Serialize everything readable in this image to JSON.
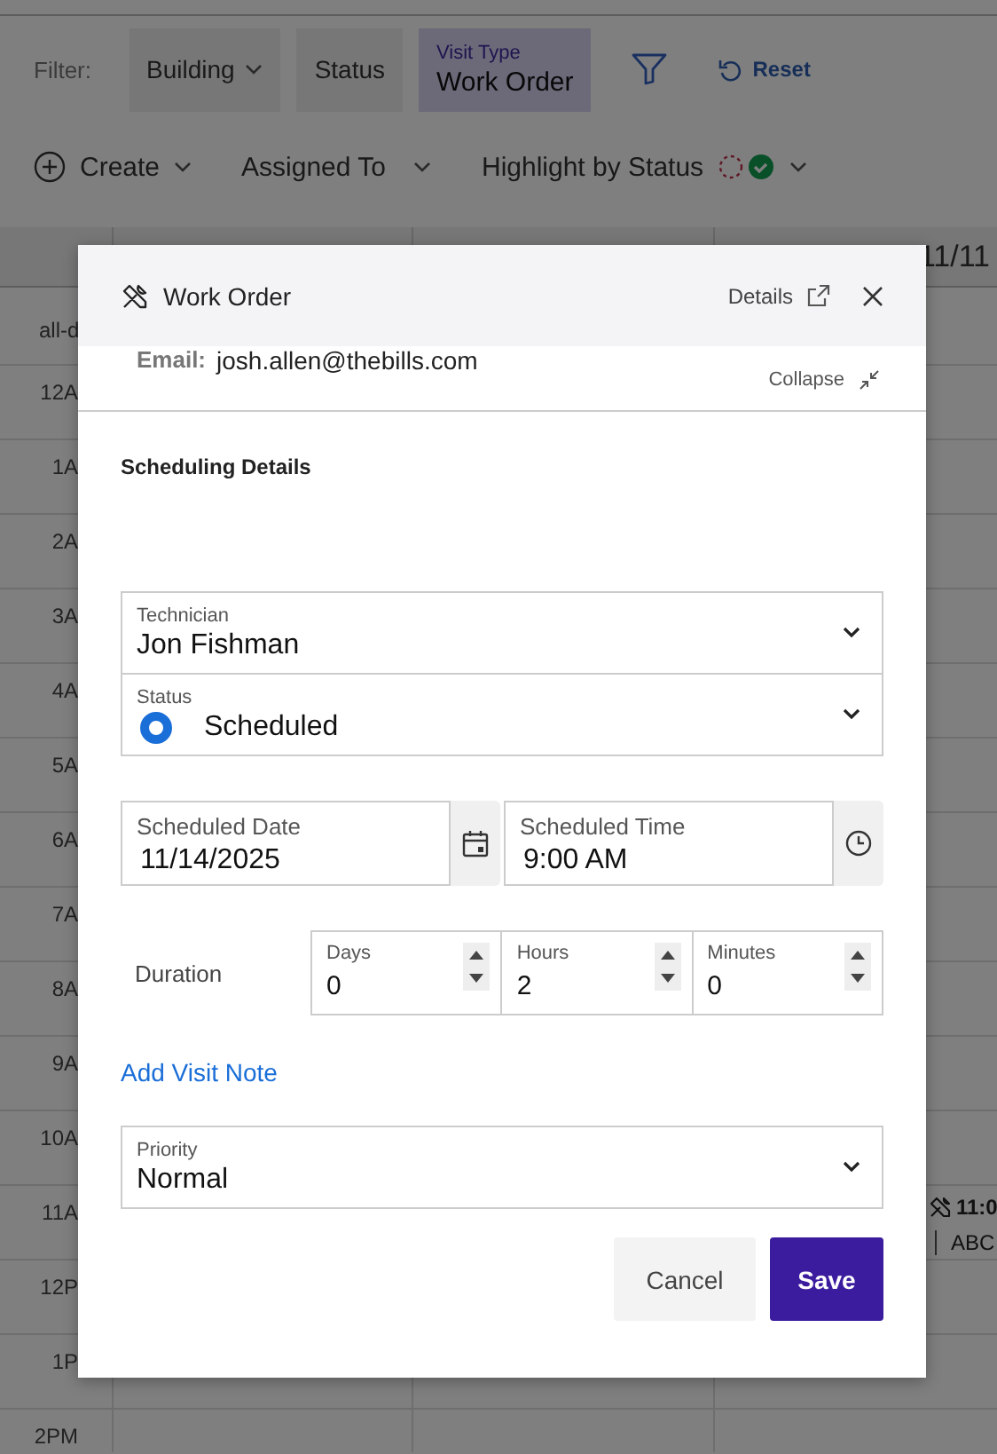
{
  "filter_bar": {
    "label": "Filter:",
    "chips": [
      {
        "kind": "dropdown",
        "label": "Building",
        "selected": false
      },
      {
        "kind": "plain",
        "label": "Status",
        "selected": false
      },
      {
        "kind": "value",
        "label": "Visit Type",
        "value": "Work Order",
        "selected": true
      }
    ],
    "reset": "Reset"
  },
  "toolbar": {
    "create": "Create",
    "assigned_to": "Assigned To",
    "highlight": "Highlight by Status"
  },
  "calendar": {
    "day_header": "11/11",
    "all_day_label": "all-d",
    "hours": [
      "12A",
      "1A",
      "2A",
      "3A",
      "4A",
      "5A",
      "6A",
      "7A",
      "8A",
      "9A",
      "10A",
      "11A",
      "12P",
      "1P",
      "2PM"
    ],
    "event": {
      "time": "11:0",
      "title": "ABC"
    }
  },
  "modal": {
    "title": "Work Order",
    "details": "Details",
    "email_label": "Email:",
    "email": "josh.allen@thebills.com",
    "collapse": "Collapse",
    "section_title": "Scheduling Details",
    "technician": {
      "label": "Technician",
      "value": "Jon Fishman"
    },
    "status": {
      "label": "Status",
      "value": "Scheduled",
      "color": "#1a6ed8"
    },
    "scheduled_date": {
      "label": "Scheduled Date",
      "value": "11/14/2025"
    },
    "scheduled_time": {
      "label": "Scheduled Time",
      "value": "9:00 AM"
    },
    "duration": {
      "label": "Duration",
      "fields": [
        {
          "label": "Days",
          "value": "0"
        },
        {
          "label": "Hours",
          "value": "2"
        },
        {
          "label": "Minutes",
          "value": "0"
        }
      ]
    },
    "add_note": "Add Visit Note",
    "priority": {
      "label": "Priority",
      "value": "Normal"
    },
    "buttons": {
      "cancel": "Cancel",
      "save": "Save"
    }
  }
}
